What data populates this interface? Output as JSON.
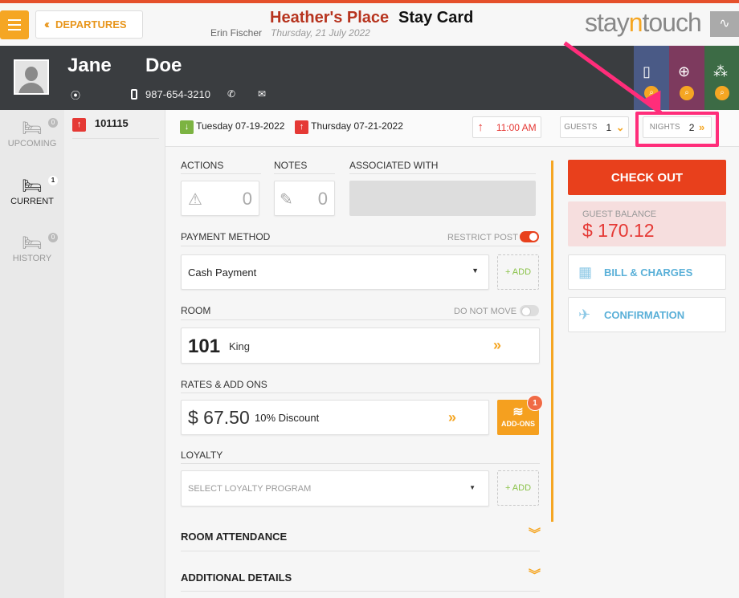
{
  "header": {
    "menu_icon": "hamburger-icon",
    "departures_label": "DEPARTURES",
    "hotel_name": "Heather's Place",
    "page_title": "Stay Card",
    "user_name": "Erin Fischer",
    "business_date": "Thursday, 21 July 2022",
    "logo_part1": "stay",
    "logo_part2": "n",
    "logo_part3": "touch"
  },
  "guest": {
    "first_name": "Jane",
    "last_name": "Doe",
    "phone": "987-654-3210"
  },
  "nav": {
    "upcoming": {
      "label": "UPCOMING",
      "count": "0"
    },
    "current": {
      "label": "CURRENT",
      "count": "1"
    },
    "history": {
      "label": "HISTORY",
      "count": "0"
    }
  },
  "reservation": {
    "number": "101115",
    "arrival": "Tuesday 07-19-2022",
    "departure": "Thursday 07-21-2022",
    "departure_time": "11:00 AM",
    "guests_label": "GUESTS",
    "guests_count": "1",
    "nights_label": "NIGHTS",
    "nights_count": "2"
  },
  "sections": {
    "actions_label": "ACTIONS",
    "actions_count": "0",
    "notes_label": "NOTES",
    "notes_count": "0",
    "associated_label": "ASSOCIATED WITH",
    "payment_label": "PAYMENT METHOD",
    "restrict_post_label": "RESTRICT POST",
    "payment_value": "Cash Payment",
    "add_label": "+ ADD",
    "room_label": "ROOM",
    "do_not_move_label": "DO NOT MOVE",
    "room_number": "101",
    "room_type": "King",
    "rates_label": "RATES & ADD ONS",
    "rate_amount": "$ 67.50",
    "rate_name": "10% Discount",
    "addons_label": "ADD-ONS",
    "addons_count": "1",
    "loyalty_label": "LOYALTY",
    "loyalty_placeholder": "SELECT LOYALTY PROGRAM",
    "room_attendance_label": "ROOM ATTENDANCE",
    "additional_details_label": "ADDITIONAL DETAILS"
  },
  "sidebar": {
    "checkout_label": "CHECK OUT",
    "balance_label": "GUEST BALANCE",
    "balance_value": "$ 170.12",
    "bill_label": "BILL & CHARGES",
    "confirmation_label": "CONFIRMATION"
  },
  "colors": {
    "accent_orange": "#f5a623",
    "checkout_red": "#e8401c",
    "annotation_pink": "#ff2d7a"
  },
  "states": {
    "restrict_post": true,
    "do_not_move": false
  }
}
